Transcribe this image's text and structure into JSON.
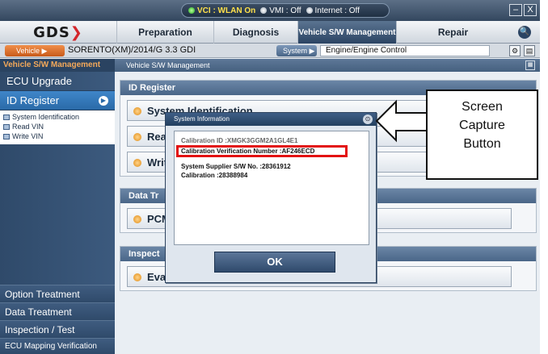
{
  "status": {
    "vci": "VCI : WLAN On",
    "vmi": "VMI : Off",
    "internet": "Internet : Off"
  },
  "window_controls": {
    "minimize": "–",
    "close": "X"
  },
  "nav": {
    "logo": "GDS",
    "tabs": [
      "Preparation",
      "Diagnosis",
      "Vehicle S/W Management",
      "Repair"
    ],
    "active_tab": "Vehicle S/W Management"
  },
  "vehicle_bar": {
    "vehicle_label": "Vehicle",
    "vehicle_value": "SORENTO(XM)/2014/G 3.3 GDI",
    "system_label": "System",
    "system_value": "Engine/Engine Control"
  },
  "sidebar": {
    "title": "Vehicle S/W Management",
    "items": [
      "ECU Upgrade",
      "ID Register"
    ],
    "active_item": "ID Register",
    "sub_items": [
      "System Identification",
      "Read VIN",
      "Write VIN"
    ],
    "bottom_items": [
      "Option Treatment",
      "Data Treatment",
      "Inspection / Test",
      "ECU Mapping Verification"
    ]
  },
  "main": {
    "title": "Vehicle S/W Management",
    "panels": [
      {
        "title": "ID Register",
        "rows": [
          "System Identification",
          "Rea",
          "Writ"
        ]
      },
      {
        "title": "Data Tr",
        "rows": [
          "PCM"
        ]
      },
      {
        "title": "Inspect",
        "rows": [
          "Eva"
        ]
      }
    ]
  },
  "dialog": {
    "title": "System Information",
    "lines": [
      "Calibration ID :XMGK3GGM2A1GL4E1",
      "Calibration Verification Number :AF246ECD",
      "System Supplier S/W No. :28361912",
      "Calibration :28388984"
    ],
    "ok_label": "OK"
  },
  "callout": {
    "lines": [
      "Screen",
      "Capture",
      "Button"
    ]
  },
  "colors": {
    "highlight": "#e31212",
    "active_tab": "#2b4463",
    "sidebar_active": "#2a6aa8",
    "logo_accent": "#d3262b"
  }
}
